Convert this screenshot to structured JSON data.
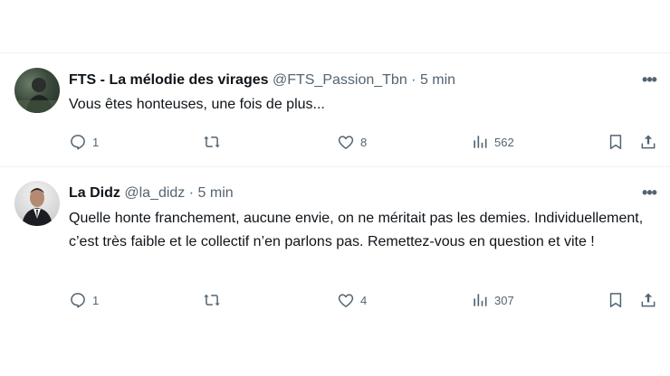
{
  "tweets": [
    {
      "name": "FTS - La mélodie des virages",
      "handle": "@FTS_Passion_Tbn",
      "dot": "·",
      "time": "5 min",
      "text": "Vous êtes honteuses, une fois de plus...",
      "replies": "1",
      "retweets": "",
      "likes": "8",
      "views": "562",
      "more": "•••"
    },
    {
      "name": "La Didz",
      "handle": "@la_didz",
      "dot": "·",
      "time": "5 min",
      "text": "Quelle honte franchement, aucune envie, on ne méritait pas les demies. Individuellement, c’est très faible et le collectif n’en parlons pas. Remettez-vous en question et vite !",
      "replies": "1",
      "retweets": "",
      "likes": "4",
      "views": "307",
      "more": "•••"
    }
  ],
  "icons": {
    "reply": "reply-icon",
    "retweet": "retweet-icon",
    "like": "heart-icon",
    "views": "views-icon",
    "bookmark": "bookmark-icon",
    "share": "share-icon"
  },
  "colors": {
    "text": "#0f1419",
    "meta": "#536471",
    "divider": "#eff3f4"
  }
}
